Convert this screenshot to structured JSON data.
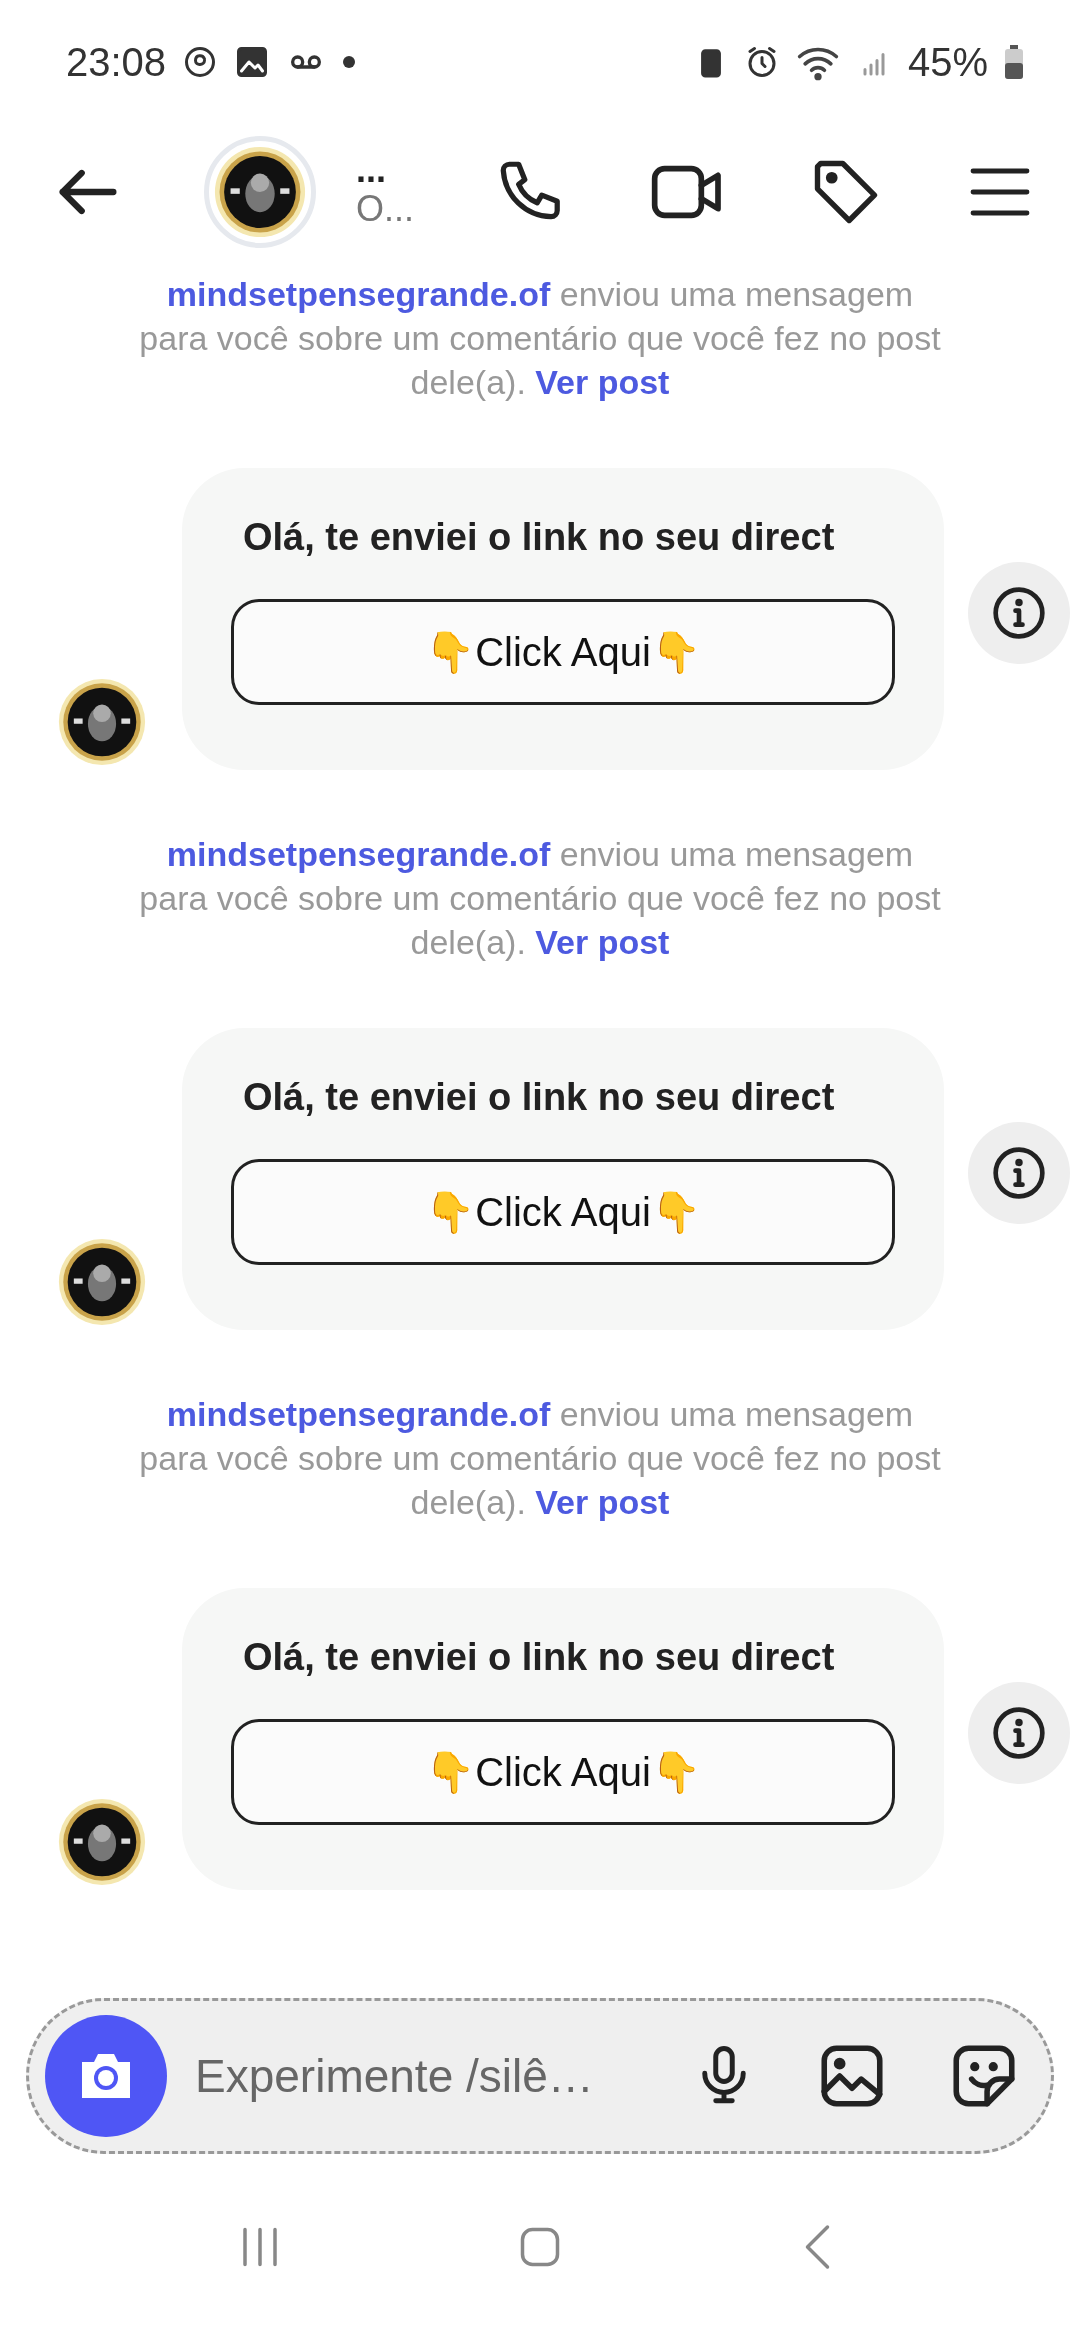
{
  "status_bar": {
    "time": "23:08",
    "battery": "45%"
  },
  "header": {
    "name": "...",
    "subtitle": "O..."
  },
  "messages": [
    {
      "notice": {
        "text": "**mindsetpensegrande.of** enviou uma mensagem para você sobre um comentário que você fez no post dele(a).",
        "link": "Ver post"
      },
      "bubble": {
        "text": "Olá, te enviei o link no seu direct",
        "button": "👇Click Aqui👇"
      }
    },
    {
      "notice": {
        "text": "**mindsetpensegrande.of** enviou uma mensagem para você sobre um comentário que você fez no post dele(a).",
        "link": "Ver post"
      },
      "bubble": {
        "text": "Olá, te enviei o link no seu direct",
        "button": "👇Click Aqui👇"
      }
    },
    {
      "notice": {
        "text": "**mindsetpensegrande.of** enviou uma mensagem para você sobre um comentário que você fez no post dele(a).",
        "link": "Ver post"
      },
      "bubble": {
        "text": "Olá, te enviei o link no seu direct",
        "button": "👇Click Aqui👇"
      }
    }
  ],
  "composer": {
    "placeholder": "Experimente /silê…"
  }
}
